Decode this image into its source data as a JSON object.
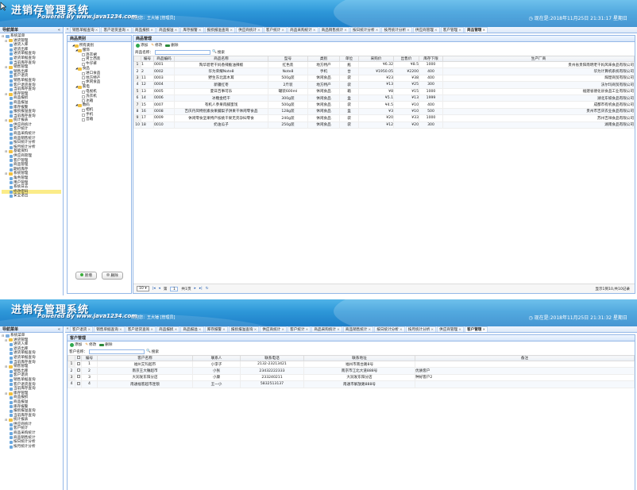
{
  "app": {
    "title": "进销存管理系统",
    "powered": "Powered By www.java1234.com",
    "icon_names": [
      "cursor-arrow",
      "clock-icon",
      "add-icon",
      "edit-icon",
      "delete-icon",
      "search-icon",
      "folder-icon",
      "leaf-icon"
    ]
  },
  "s1": {
    "welcome": "欢迎您：王大锤 [管理员]",
    "clock": "现在是:2018年11月25日 21:31:17 星期日",
    "nav_title": "导航菜单",
    "tree": [
      {
        "label": "系统菜单",
        "level": 0
      },
      {
        "label": "进货管理",
        "level": 1
      },
      {
        "label": "进货入库",
        "level": 2
      },
      {
        "label": "退货出库",
        "level": 2
      },
      {
        "label": "进货单据查询",
        "level": 2
      },
      {
        "label": "退货单据查询",
        "level": 2
      },
      {
        "label": "当前库存查询",
        "level": 2
      },
      {
        "label": "销售管理",
        "level": 1
      },
      {
        "label": "销售出库",
        "level": 2
      },
      {
        "label": "客户退货",
        "level": 2
      },
      {
        "label": "销售单据查询",
        "level": 2
      },
      {
        "label": "客户退货查询",
        "level": 2
      },
      {
        "label": "当前库存查询",
        "level": 2
      },
      {
        "label": "库存管理",
        "level": 1
      },
      {
        "label": "商品报损",
        "level": 2
      },
      {
        "label": "商品报溢",
        "level": 2
      },
      {
        "label": "库存报警",
        "level": 2
      },
      {
        "label": "报损报溢查询",
        "level": 2
      },
      {
        "label": "当前库存查询",
        "level": 2
      },
      {
        "label": "统计报表",
        "level": 1
      },
      {
        "label": "供应商统计",
        "level": 2
      },
      {
        "label": "客户统计",
        "level": 2
      },
      {
        "label": "商品采购统计",
        "level": 2
      },
      {
        "label": "商品销售统计",
        "level": 2
      },
      {
        "label": "按日统计分析",
        "level": 2
      },
      {
        "label": "按月统计分析",
        "level": 2
      },
      {
        "label": "基础资料",
        "level": 1
      },
      {
        "label": "供应商管理",
        "level": 2
      },
      {
        "label": "客户管理",
        "level": 2
      },
      {
        "label": "商品管理",
        "level": 2
      },
      {
        "label": "期初库存",
        "level": 2
      },
      {
        "label": "系统管理",
        "level": 1
      },
      {
        "label": "角色管理",
        "level": 2
      },
      {
        "label": "用户管理",
        "level": 2
      },
      {
        "label": "系统日志",
        "level": 2
      },
      {
        "label": "修改密码",
        "level": 2
      },
      {
        "label": "安全退出",
        "level": 2
      }
    ],
    "tabs": [
      "销售单据查询",
      "客户退货查询",
      "商品报损",
      "商品报溢",
      "库存报警",
      "报损报溢查询",
      "供应商统计",
      "客户统计",
      "商品采购统计",
      "商品销售统计",
      "按日统计分析",
      "按月统计分析",
      "供应商管理",
      "客户管理",
      "商品管理"
    ],
    "active_tab": "商品管理",
    "category_title": "商品类别",
    "categories": [
      {
        "label": "所有类别",
        "d": 0,
        "type": "folder"
      },
      {
        "label": "服饰",
        "d": 1,
        "type": "folder"
      },
      {
        "label": "连衣裙",
        "d": 2,
        "type": "leaf"
      },
      {
        "label": "男士西装",
        "d": 2,
        "type": "leaf"
      },
      {
        "label": "牛仔裤",
        "d": 2,
        "type": "leaf"
      },
      {
        "label": "食品",
        "d": 1,
        "type": "folder"
      },
      {
        "label": "进口食品",
        "d": 2,
        "type": "leaf"
      },
      {
        "label": "地方特产",
        "d": 2,
        "type": "leaf"
      },
      {
        "label": "休闲食品",
        "d": 2,
        "type": "leaf"
      },
      {
        "label": "家电",
        "d": 1,
        "type": "folder"
      },
      {
        "label": "电视机",
        "d": 2,
        "type": "leaf"
      },
      {
        "label": "洗衣机",
        "d": 2,
        "type": "leaf"
      },
      {
        "label": "冰箱",
        "d": 2,
        "type": "leaf"
      },
      {
        "label": "数码",
        "d": 1,
        "type": "folder"
      },
      {
        "label": "相机",
        "d": 2,
        "type": "leaf"
      },
      {
        "label": "手机",
        "d": 2,
        "type": "leaf"
      },
      {
        "label": "音箱",
        "d": 2,
        "type": "leaf"
      }
    ],
    "cat_add": "新增",
    "cat_del": "删除",
    "goods_title": "商品管理",
    "toolbar": {
      "add": "添加",
      "edit": "修改",
      "del": "删除"
    },
    "search_label": "商品名称：",
    "search_btn": "搜索",
    "columns": [
      "编号",
      "商品编码",
      "商品名称",
      "型号",
      "类别",
      "单位",
      "采购价",
      "出售价",
      "库存下限",
      "生产厂商"
    ],
    "rows": [
      [
        "1",
        "0001",
        "陶华碧老干妈香辣脆油辣椒",
        "红色装",
        "地方特产",
        "瓶",
        "¥6.32",
        "¥8.5",
        "1000",
        "贵州省贵阳南明老干妈风味食品有限公司"
      ],
      [
        "2",
        "0002",
        "华为荣耀Note8",
        "Note8",
        "手机",
        "台",
        "¥1950.05",
        "¥2200",
        "400",
        "华为计算机系统有限公司"
      ],
      [
        "11",
        "0003",
        "野生东北黑木耳",
        "500g装",
        "休闲食品",
        "袋",
        "¥23",
        "¥38",
        "400",
        "辉煌商贸有限公司"
      ],
      [
        "12",
        "0004",
        "新疆红枣",
        "2斤装",
        "地方特产",
        "袋",
        "¥13",
        "¥25",
        "300",
        "沃尔玛商贸有限公司"
      ],
      [
        "13",
        "0005",
        "夏日百事可乐",
        "罐装600ml",
        "休闲食品",
        "箱",
        "¥8",
        "¥15",
        "1000",
        "福建省德化县食品工业有限公司"
      ],
      [
        "14",
        "0006",
        "冰糖金桔干",
        "300g装",
        "休闲食品",
        "盒",
        "¥5.1",
        "¥13",
        "1999",
        "湖北东坡食品有限公司"
      ],
      [
        "15",
        "0007",
        "有机人参果肉脯蜜饯",
        "500g装",
        "休闲食品",
        "袋",
        "¥4.5",
        "¥10",
        "400",
        "成都市有机食品有限公司"
      ],
      [
        "16",
        "0008",
        "吉庆丹凤特别素食果脯梨子饼果干休闲零食品",
        "128g装",
        "休闲食品",
        "盒",
        "¥3",
        "¥10",
        "500",
        "贵州市吉庆农业食品有限公司"
      ],
      [
        "17",
        "0009",
        "休闲零食坚果特产核桃干果无壳孕妇零食",
        "240g装",
        "休闲食品",
        "袋",
        "¥20",
        "¥33",
        "1000",
        "苏州吉祥食品有限公司"
      ],
      [
        "18",
        "0010",
        "奶油瓜子",
        "250g装",
        "休闲食品",
        "袋",
        "¥12",
        "¥20",
        "300",
        "湖南食品有限公司"
      ]
    ],
    "pager": {
      "size": "10",
      "page_prefix": "第",
      "page": "1",
      "page_suffix": "共1页",
      "info": "显示1到10,共10记录"
    }
  },
  "s2": {
    "welcome": "欢迎您：王大锤 [管理员]",
    "clock": "现在是:2018年11月25日 21:31:32 星期日",
    "nav_title": "导航菜单",
    "tree": [
      {
        "label": "系统菜单",
        "level": 0
      },
      {
        "label": "进货管理",
        "level": 1
      },
      {
        "label": "进货入库",
        "level": 2
      },
      {
        "label": "退货出库",
        "level": 2
      },
      {
        "label": "进货单据查询",
        "level": 2
      },
      {
        "label": "退货单据查询",
        "level": 2
      },
      {
        "label": "当前库存查询",
        "level": 2
      },
      {
        "label": "销售管理",
        "level": 1
      },
      {
        "label": "销售出库",
        "level": 2
      },
      {
        "label": "客户退货",
        "level": 2
      },
      {
        "label": "销售单据查询",
        "level": 2
      },
      {
        "label": "客户退货查询",
        "level": 2
      },
      {
        "label": "当前库存查询",
        "level": 2
      },
      {
        "label": "库存管理",
        "level": 1
      },
      {
        "label": "商品报损",
        "level": 2
      },
      {
        "label": "商品报溢",
        "level": 2
      },
      {
        "label": "库存报警",
        "level": 2
      },
      {
        "label": "报损报溢查询",
        "level": 2
      },
      {
        "label": "当前库存查询",
        "level": 2
      },
      {
        "label": "统计报表",
        "level": 1
      },
      {
        "label": "供应商统计",
        "level": 2
      },
      {
        "label": "客户统计",
        "level": 2
      },
      {
        "label": "商品采购统计",
        "level": 2
      },
      {
        "label": "商品销售统计",
        "level": 2
      },
      {
        "label": "按日统计分析",
        "level": 2
      },
      {
        "label": "按月统计分析",
        "level": 2
      }
    ],
    "tabs": [
      "客户退货",
      "销售单据查询",
      "客户退货查询",
      "商品报损",
      "商品报溢",
      "库存报警",
      "报损报溢查询",
      "供应商统计",
      "客户统计",
      "商品采购统计",
      "商品销售统计",
      "按日统计分析",
      "按月统计分析",
      "供应商管理",
      "客户管理"
    ],
    "active_tab": "客户管理",
    "panel_title": "客户管理",
    "toolbar": {
      "add": "添加",
      "edit": "修改",
      "del": "删除"
    },
    "search_label": "客户名称：",
    "search_btn": "搜索",
    "columns": [
      "编号",
      "客户名称",
      "联系人",
      "联系电话",
      "联系地址",
      "备注"
    ],
    "rows": [
      [
        "1",
        "福州艾玛超市",
        "小李子",
        "2132-23213421",
        "福州市南台路8号",
        ""
      ],
      [
        "2",
        "南京王大锤超市",
        "小张",
        "23432222333",
        "南京市江北大道888号",
        "优质客户"
      ],
      [
        "3",
        "大润发东阳分店",
        "小康",
        "233240211",
        "大润发东阳分店",
        "种好客户2"
      ],
      [
        "4",
        "南通福客超市连锁",
        "王一小",
        "5832513137",
        "南通市解放路888号",
        ""
      ]
    ]
  }
}
